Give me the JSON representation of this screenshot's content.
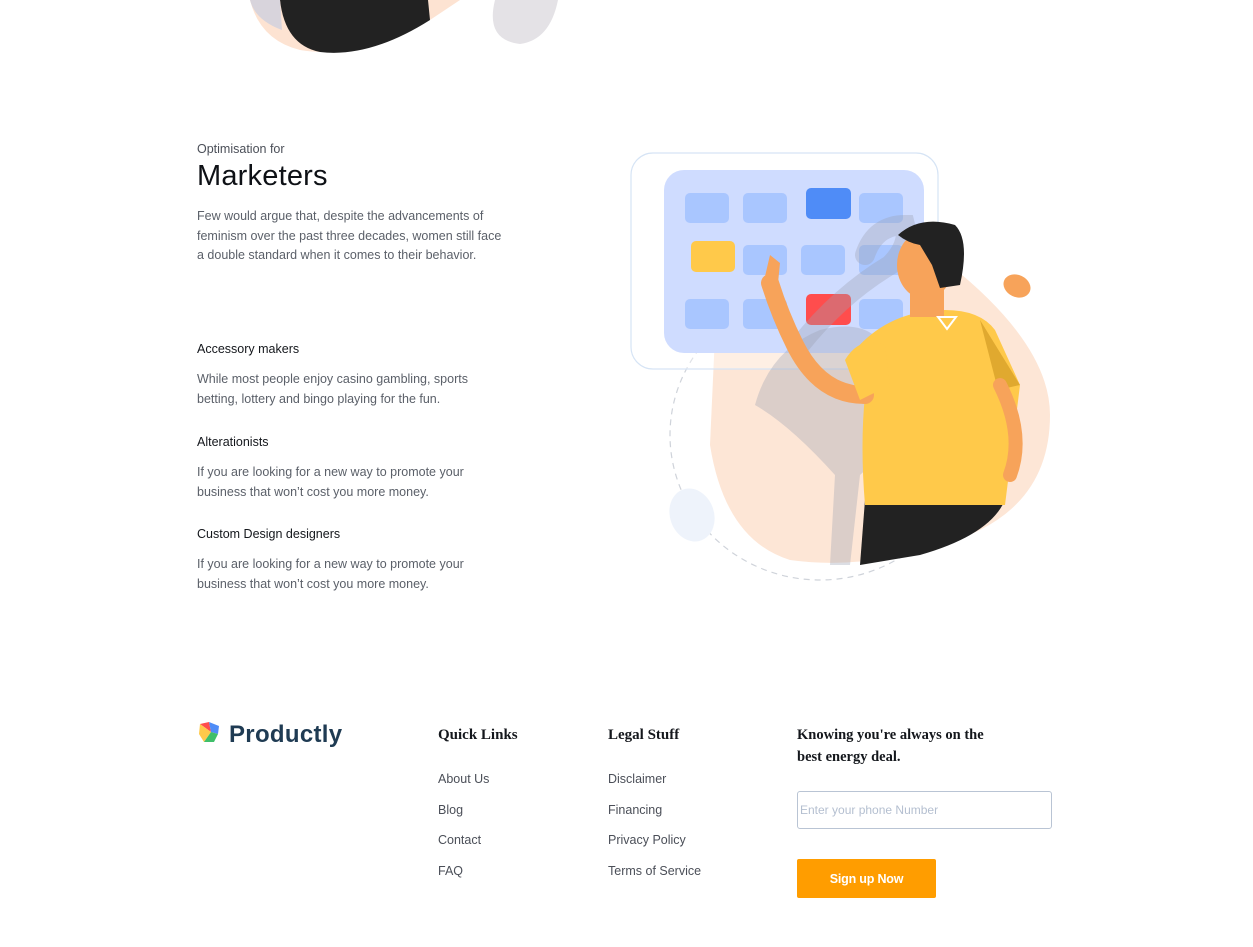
{
  "feature": {
    "eyebrow": "Optimisation for",
    "title": "Marketers",
    "description": "Few would argue that, despite the advancements of feminism over the past three decades, women still face a double standard when it comes to their behavior."
  },
  "items": [
    {
      "title": "Accessory makers",
      "text": "While most people enjoy casino gambling, sports betting, lottery and bingo playing for the fun."
    },
    {
      "title": "Alterationists",
      "text": "If you are looking for a new way to promote your business that won’t cost you more money."
    },
    {
      "title": "Custom Design designers",
      "text": "If you are looking for a new way to promote your business that won’t cost you more money."
    }
  ],
  "footer": {
    "brand": "Productly",
    "quick_links": {
      "title": "Quick Links",
      "links": [
        "About Us",
        "Blog",
        "Contact",
        "FAQ"
      ]
    },
    "legal": {
      "title": "Legal Stuff",
      "links": [
        "Disclaimer",
        "Financing",
        "Privacy Policy",
        "Terms of Service"
      ]
    },
    "newsletter": {
      "tagline": "Knowing you're always on the best energy deal.",
      "phone_placeholder": "Enter your phone Number",
      "button_label": "Sign up Now"
    }
  },
  "colors": {
    "brand_text": "#1f3b53",
    "cta": "#ff9d00",
    "shirt": "#ffc94a",
    "board_cell": "#a9c6ff",
    "accent_red": "#ff4d4d"
  }
}
